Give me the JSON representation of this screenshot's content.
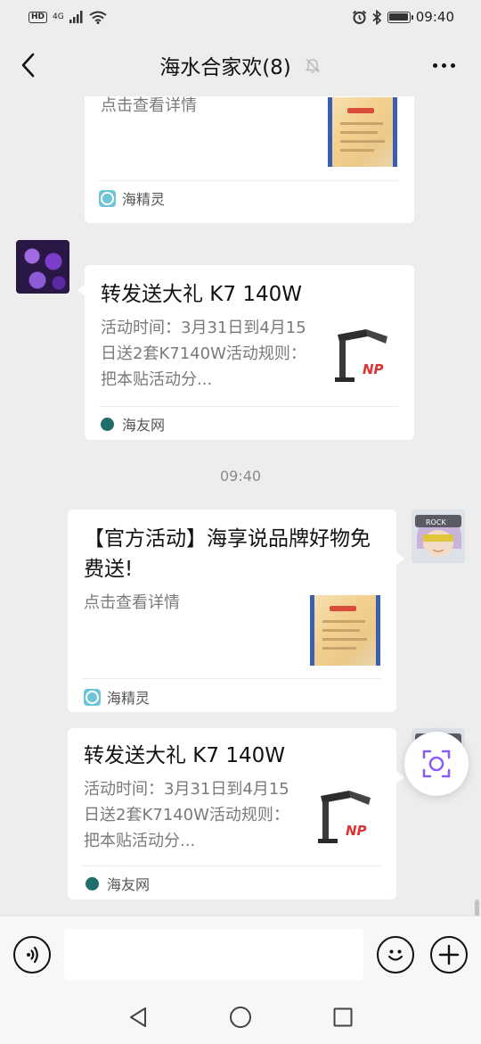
{
  "status_bar": {
    "network": "HD",
    "signal": "4G",
    "time": "09:40",
    "icons": [
      "hd-icon",
      "signal-icon",
      "wifi-icon",
      "alarm-icon",
      "bluetooth-icon",
      "battery-icon"
    ]
  },
  "header": {
    "title": "海水合家欢(8)",
    "icons": [
      "back-arrow-icon",
      "mute-bell-icon",
      "more-dots-icon"
    ]
  },
  "messages": [
    {
      "side": "left",
      "partial": true,
      "desc": "点击查看详情",
      "source": "海精灵",
      "thumb": "poster"
    },
    {
      "side": "left",
      "avatar": "coral-avatar",
      "title": "转发送大礼 K7 140W",
      "desc": "活动时间：3月31日到4月15日送2套K7140W活动规则：把本贴活动分...",
      "source": "海友网",
      "thumb": "lamp"
    },
    {
      "type": "time",
      "text": "09:40"
    },
    {
      "side": "right",
      "avatar": "girl-avatar",
      "title": "【官方活动】海享说品牌好物免费送!",
      "desc": "点击查看详情",
      "source": "海精灵",
      "thumb": "poster"
    },
    {
      "side": "right",
      "avatar": "girl-avatar",
      "title": "转发送大礼 K7 140W",
      "desc": "活动时间：3月31日到4月15日送2套K7140W活动规则：把本贴活动分...",
      "source": "海友网",
      "thumb": "lamp"
    }
  ],
  "input_bar": {
    "text_value": "",
    "icons": [
      "voice-icon",
      "emoji-icon",
      "plus-icon"
    ]
  },
  "floating_button": {
    "icon": "screen-recognition-icon"
  },
  "nav_bar": {
    "icons": [
      "back-triangle-icon",
      "home-circle-icon",
      "recents-square-icon"
    ]
  },
  "colors": {
    "background": "#ededed",
    "card": "#ffffff",
    "accent_purple": "#8a5cf6"
  }
}
